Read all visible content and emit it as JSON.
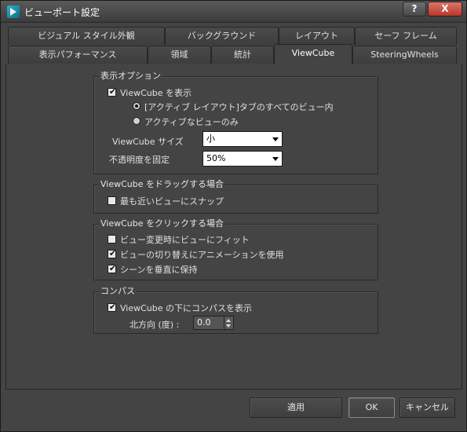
{
  "window": {
    "title": "ビューポート設定",
    "help_label": "?",
    "close_label": "X"
  },
  "tabs_row1": [
    {
      "label": "ビジュアル スタイル外観"
    },
    {
      "label": "バックグラウンド"
    },
    {
      "label": "レイアウト"
    },
    {
      "label": "セーフ フレーム"
    }
  ],
  "tabs_row2": [
    {
      "label": "表示パフォーマンス"
    },
    {
      "label": "領域"
    },
    {
      "label": "統計"
    },
    {
      "label": "ViewCube",
      "active": true
    },
    {
      "label": "SteeringWheels"
    }
  ],
  "display_options": {
    "title": "表示オプション",
    "show_viewcube_label": "ViewCube を表示",
    "show_viewcube_checked": true,
    "radio_all_label": "[アクティブ レイアウト]タブのすべてのビュー内",
    "radio_all_selected": true,
    "radio_active_label": "アクティブなビューのみ",
    "radio_active_selected": false,
    "size_label": "ViewCube サイズ",
    "size_value": "小",
    "opacity_label": "不透明度を固定",
    "opacity_value": "50%"
  },
  "drag": {
    "title": "ViewCube をドラッグする場合",
    "snap_label": "最も近いビューにスナップ",
    "snap_checked": false
  },
  "click": {
    "title": "ViewCube をクリックする場合",
    "fit_label": "ビュー変更時にビューにフィット",
    "fit_checked": false,
    "animate_label": "ビューの切り替えにアニメーションを使用",
    "animate_checked": true,
    "upright_label": "シーンを垂直に保持",
    "upright_checked": true
  },
  "compass": {
    "title": "コンパス",
    "show_label": "ViewCube の下にコンパスを表示",
    "show_checked": true,
    "north_label": "北方向 (度) :",
    "north_value": "0.0"
  },
  "buttons": {
    "apply": "適用",
    "ok": "OK",
    "cancel": "キャンセル"
  },
  "check_mark": "✔"
}
